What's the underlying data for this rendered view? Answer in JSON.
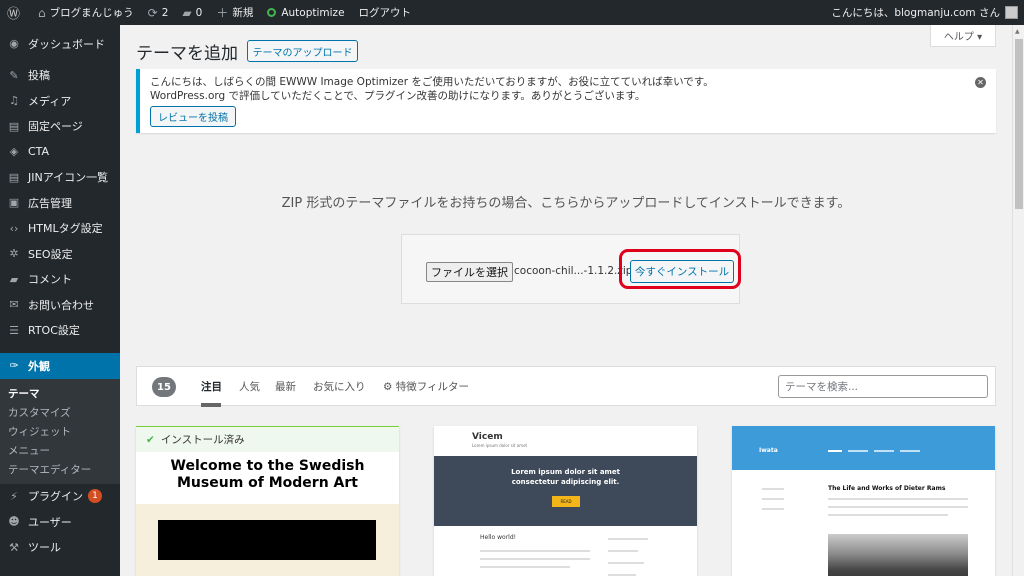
{
  "adminbar": {
    "site_name": "ブログまんじゅう",
    "updates": "2",
    "comments": "0",
    "new": "新規",
    "autoptimize": "Autoptimize",
    "logout": "ログアウト",
    "greeting": "こんにちは、blogmanju.com さん"
  },
  "sidebar": {
    "dashboard": "ダッシュボード",
    "posts": "投稿",
    "media": "メディア",
    "pages": "固定ページ",
    "cta": "CTA",
    "jin_icons": "JINアイコン一覧",
    "ads": "広告管理",
    "html_tags": "HTMLタグ設定",
    "seo": "SEO設定",
    "comments": "コメント",
    "contact": "お問い合わせ",
    "rtoc": "RTOC設定",
    "appearance": "外観",
    "sub_themes": "テーマ",
    "sub_customize": "カスタマイズ",
    "sub_widgets": "ウィジェット",
    "sub_menus": "メニュー",
    "sub_editor": "テーマエディター",
    "plugins": "プラグイン",
    "plugins_badge": "1",
    "users": "ユーザー",
    "tools": "ツール"
  },
  "main": {
    "title": "テーマを追加",
    "upload_button": "テーマのアップロード",
    "help": "ヘルプ ▾",
    "notice_line1": "こんにちは、しばらくの間 EWWW Image Optimizer をご使用いただいておりますが、お役に立てていれば幸いです。",
    "notice_line2": "WordPress.org で評価していただくことで、プラグイン改善の助けになります。ありがとうございます。",
    "review_button": "レビューを投稿",
    "upload_desc": "ZIP 形式のテーマファイルをお持ちの場合、こちらからアップロードしてインストールできます。",
    "choose_file": "ファイルを選択",
    "file_name": "cocoon-chil...-1.1.2.zip",
    "install_now": "今すぐインストール"
  },
  "filter": {
    "count": "15",
    "tabs": [
      "注目",
      "人気",
      "最新",
      "お気に入り"
    ],
    "feature_filter": "特徴フィルター",
    "search_placeholder": "テーマを検索..."
  },
  "cards": {
    "installed": "インストール済み",
    "swedish_title_1": "Welcome to the Swedish",
    "swedish_title_2": "Museum of Modern Art",
    "vicem_logo": "Vicem",
    "vicem_tag": "Lorem ipsum dolor sit amet",
    "vicem_hero_1": "Lorem ipsum dolor sit amet",
    "vicem_hero_2": "consectetur adipiscing elit.",
    "vicem_btn": "READ",
    "vicem_body": "Hello world!",
    "iwata_logo": "Iwata",
    "iwata_title": "The Life and Works of Dieter Rams"
  }
}
